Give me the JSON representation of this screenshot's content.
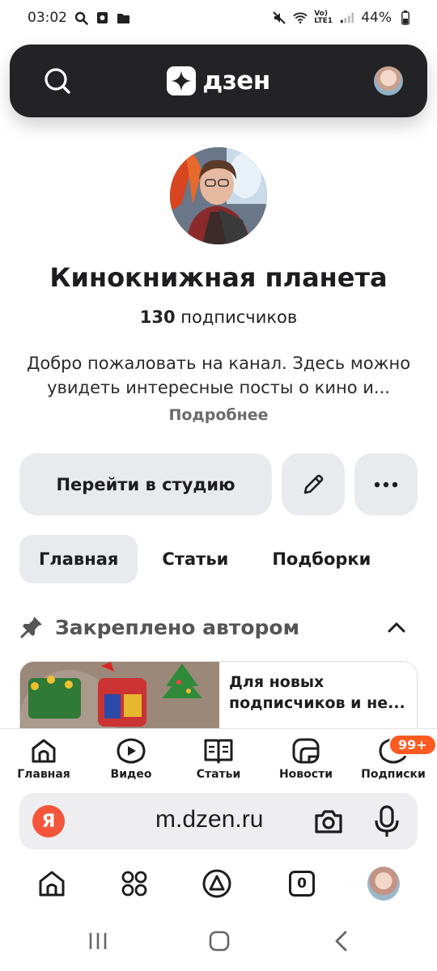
{
  "status_bar": {
    "time": "03:02",
    "battery": "44%",
    "net_label": "Vo) LTE1"
  },
  "header": {
    "logo_text": "дзен"
  },
  "channel": {
    "title": "Кинокнижная планета",
    "subscribers_count": "130",
    "subscribers_label": "подписчиков",
    "description_line1": "Добро пожаловать на канал. Здесь можно",
    "description_line2": "увидеть интересные посты о кино и...",
    "more_label": "Подробнее"
  },
  "actions": {
    "studio_label": "Перейти в студию"
  },
  "tabs": [
    {
      "label": "Главная",
      "active": true
    },
    {
      "label": "Статьи",
      "active": false
    },
    {
      "label": "Подборки",
      "active": false
    }
  ],
  "pinned": {
    "label": "Закреплено автором",
    "card_title_line1": "Для новых",
    "card_title_line2": "подписчиков и не..."
  },
  "site_nav": [
    {
      "label": "Главная",
      "icon": "home-icon"
    },
    {
      "label": "Видео",
      "icon": "video-icon"
    },
    {
      "label": "Статьи",
      "icon": "articles-icon"
    },
    {
      "label": "Новости",
      "icon": "news-icon"
    },
    {
      "label": "Подписки",
      "icon": "subscriptions-icon",
      "badge": "99+"
    }
  ],
  "browser": {
    "logo_letter": "Я",
    "url": "m.dzen.ru",
    "tab_count": "0"
  },
  "colors": {
    "header_bg": "#232325",
    "chip_bg": "#e9eaee",
    "badge": "#ff5a1f",
    "yandex_red": "#f5553a"
  }
}
